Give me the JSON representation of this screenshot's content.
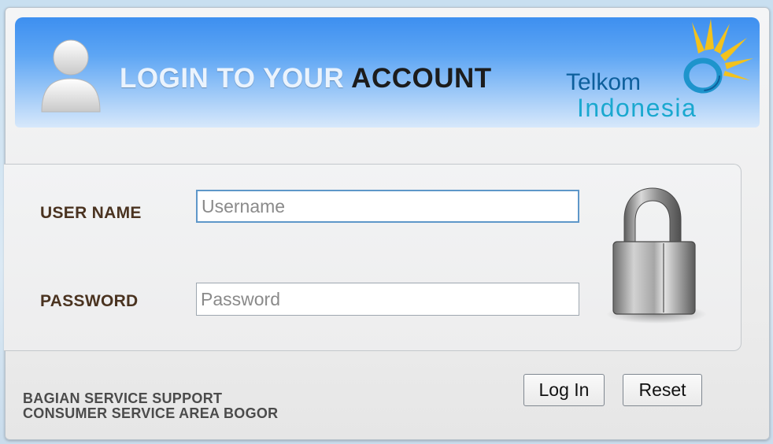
{
  "header": {
    "title_part1": "LOGIN TO YOUR ",
    "title_part2": "ACCOUNT"
  },
  "logo": {
    "name": "Telkom",
    "sub": "Indonesia"
  },
  "form": {
    "username_label": "USER NAME",
    "username_placeholder": "Username",
    "username_value": "",
    "password_label": "PASSWORD",
    "password_placeholder": "Password",
    "password_value": ""
  },
  "buttons": {
    "login": "Log In",
    "reset": "Reset"
  },
  "footer": {
    "line1": "BAGIAN SERVICE SUPPORT",
    "line2": "CONSUMER SERVICE AREA BOGOR"
  },
  "icons": {
    "avatar": "user-avatar-icon",
    "lock": "padlock-icon",
    "logo_mark": "telkom-sun-icon"
  },
  "colors": {
    "header_blue": "#3d8ff0",
    "logo_dark_blue": "#0d5f9c",
    "logo_light_blue": "#1aa8cf",
    "logo_yellow": "#f3c21c",
    "label_brown": "#4a3320"
  }
}
